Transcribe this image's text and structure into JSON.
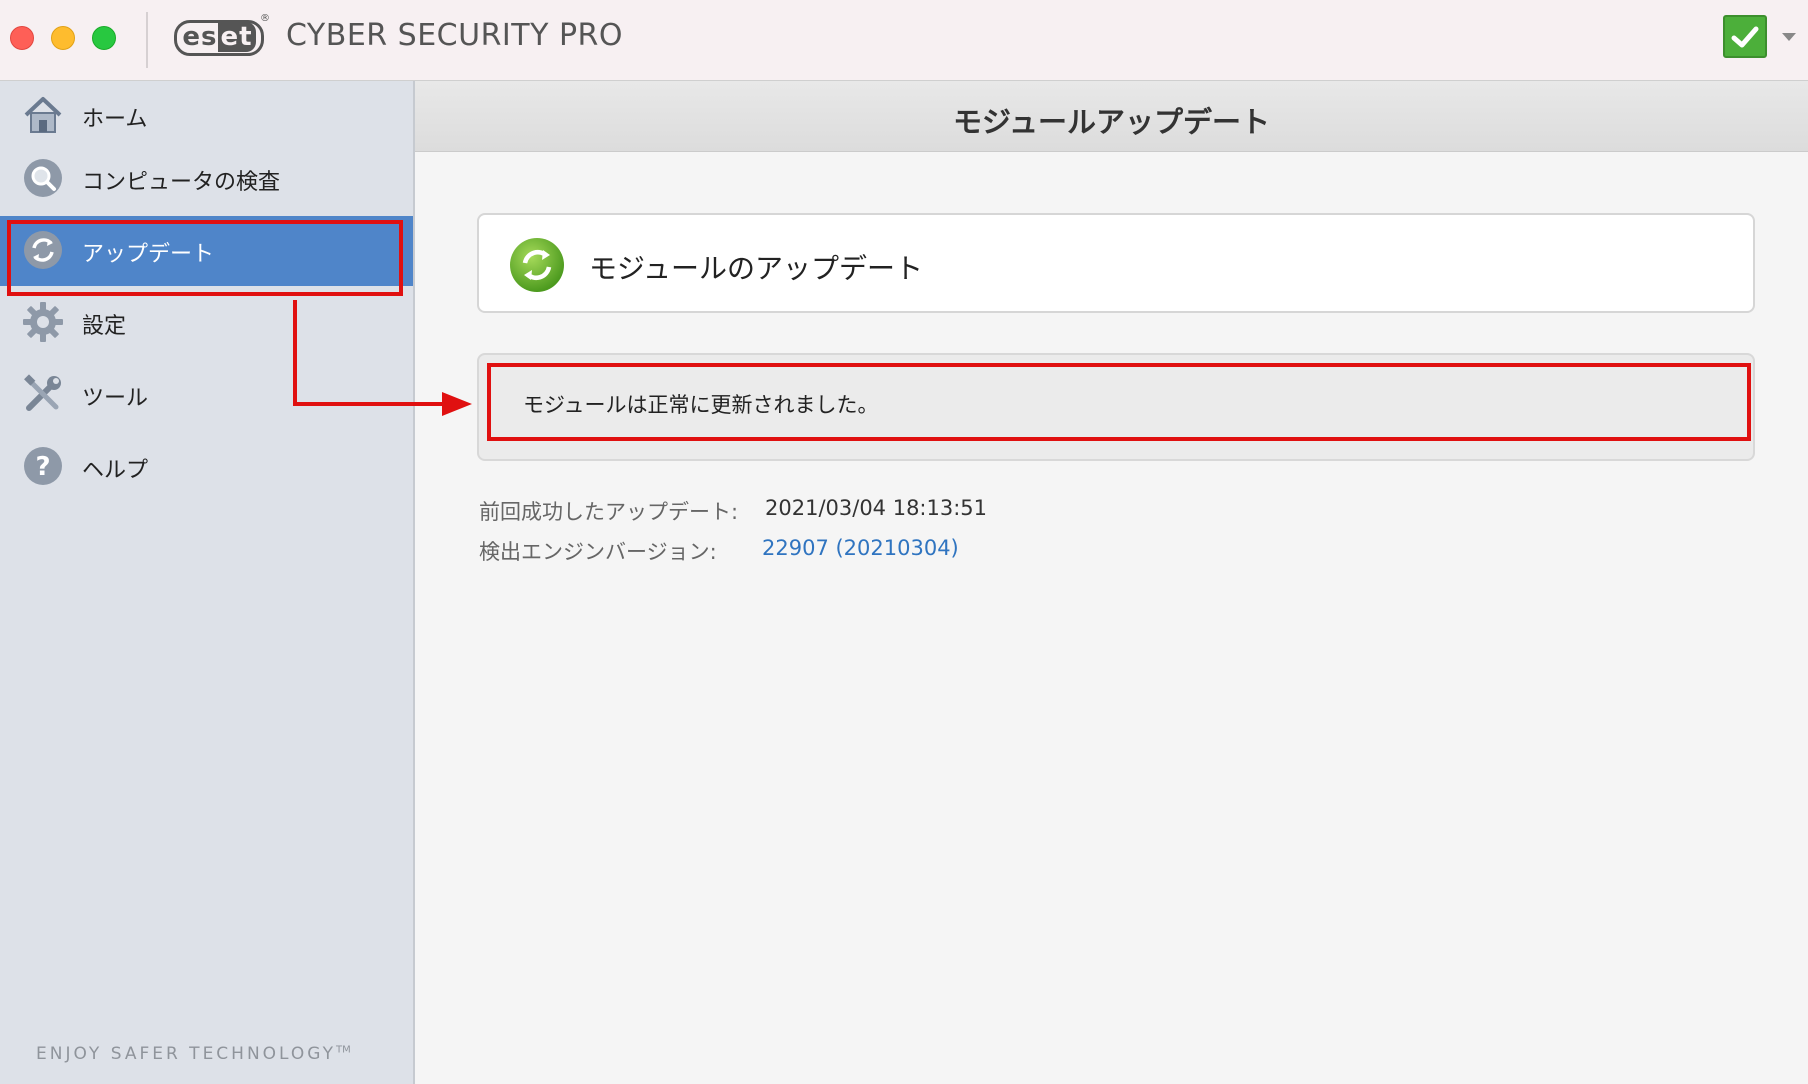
{
  "window": {
    "brand": "eset",
    "app_title": "CYBER SECURITY PRO",
    "protection_status": "check-icon"
  },
  "sidebar": {
    "items": [
      {
        "label": "ホーム",
        "icon": "home-icon"
      },
      {
        "label": "コンピュータの検査",
        "icon": "scan-magnifier-icon"
      },
      {
        "label": "アップデート",
        "icon": "update-icon",
        "active": true
      },
      {
        "label": "設定",
        "icon": "gear-icon"
      },
      {
        "label": "ツール",
        "icon": "tools-icon"
      },
      {
        "label": "ヘルプ",
        "icon": "help-icon"
      }
    ],
    "footer": "ENJOY SAFER TECHNOLOGY",
    "footer_tm": "TM"
  },
  "main": {
    "title": "モジュールアップデート",
    "update_card_label": "モジュールのアップデート",
    "status_message": "モジュールは正常に更新されました。",
    "info": {
      "last_update_label": "前回成功したアップデート:",
      "last_update_value": "2021/03/04 18:13:51",
      "engine_label": "検出エンジンバージョン:",
      "engine_value": "22907 (20210304)"
    }
  },
  "colors": {
    "sidebar_active": "#4f85c9",
    "annotation_red": "#e01010",
    "link_blue": "#2f74c0",
    "status_green": "#4caf3a"
  }
}
